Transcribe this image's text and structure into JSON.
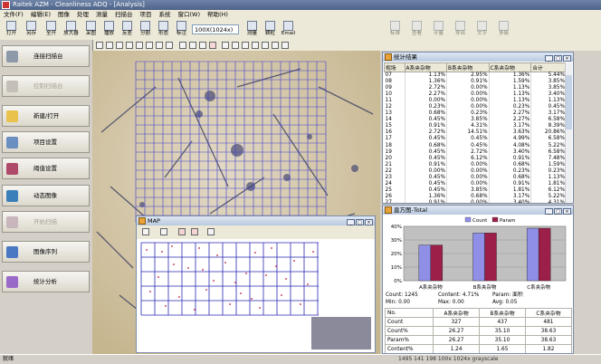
{
  "app": {
    "title": "Raitek AZM - Cleanliness ADQ - [Analysis]"
  },
  "menu": [
    "文件(F)",
    "编辑(E)",
    "图像",
    "处理",
    "测量",
    "扫描台",
    "项目",
    "系统",
    "窗口(W)",
    "帮助(H)"
  ],
  "toolbar": {
    "buttons": [
      "打开",
      "另存",
      "全开",
      "放大器",
      "采图",
      "播放",
      "反差",
      "分割",
      "形态",
      "标注"
    ],
    "zoom_value": "100X(1024x)",
    "extra_buttons": [
      "测量",
      "颗粒",
      "Email"
    ],
    "right_buttons": [
      "标准",
      "查看",
      "计量",
      "导出",
      "文字",
      "多级"
    ]
  },
  "sidebar": {
    "items": [
      {
        "label": "连接扫描台",
        "enabled": true
      },
      {
        "label": "控制扫描台",
        "enabled": false
      },
      {
        "label": "新建/打开",
        "enabled": true
      },
      {
        "label": "项目设置",
        "enabled": true
      },
      {
        "label": "阈值设置",
        "enabled": true
      },
      {
        "label": "动态图像",
        "enabled": true
      },
      {
        "label": "开始扫描",
        "enabled": false
      },
      {
        "label": "图像序列",
        "enabled": true
      },
      {
        "label": "统计分析",
        "enabled": true
      }
    ]
  },
  "map_window": {
    "title": "MAP"
  },
  "stats_window": {
    "title": "统计结果",
    "columns": [
      "视场",
      "A系夹杂物",
      "B系夹杂物",
      "C系夹杂物",
      "合计"
    ],
    "rows": [
      [
        "07",
        "1.13%",
        "2.95%",
        "1.36%",
        "5.44%"
      ],
      [
        "08",
        "1.36%",
        "0.91%",
        "1.59%",
        "3.85%"
      ],
      [
        "09",
        "2.72%",
        "0.00%",
        "1.13%",
        "3.85%"
      ],
      [
        "10",
        "2.27%",
        "0.00%",
        "1.13%",
        "3.40%"
      ],
      [
        "11",
        "0.00%",
        "0.00%",
        "1.13%",
        "1.13%"
      ],
      [
        "12",
        "0.23%",
        "0.00%",
        "0.23%",
        "0.45%"
      ],
      [
        "13",
        "0.68%",
        "0.23%",
        "2.27%",
        "3.17%"
      ],
      [
        "14",
        "0.45%",
        "3.85%",
        "2.27%",
        "6.58%"
      ],
      [
        "15",
        "0.91%",
        "4.31%",
        "3.17%",
        "8.39%"
      ],
      [
        "16",
        "2.72%",
        "14.51%",
        "3.63%",
        "20.86%"
      ],
      [
        "17",
        "0.45%",
        "0.45%",
        "4.99%",
        "6.58%"
      ],
      [
        "18",
        "0.68%",
        "0.45%",
        "4.08%",
        "5.22%"
      ],
      [
        "19",
        "0.45%",
        "2.72%",
        "3.40%",
        "6.58%"
      ],
      [
        "20",
        "0.45%",
        "6.12%",
        "0.91%",
        "7.48%"
      ],
      [
        "21",
        "0.91%",
        "0.00%",
        "0.68%",
        "1.59%"
      ],
      [
        "22",
        "0.00%",
        "0.00%",
        "0.23%",
        "0.23%"
      ],
      [
        "23",
        "0.45%",
        "0.00%",
        "0.68%",
        "1.13%"
      ],
      [
        "24",
        "0.45%",
        "0.00%",
        "0.91%",
        "1.81%"
      ],
      [
        "25",
        "0.45%",
        "3.85%",
        "1.81%",
        "6.12%"
      ],
      [
        "26",
        "1.36%",
        "0.68%",
        "3.17%",
        "5.22%"
      ],
      [
        "27",
        "0.91%",
        "0.00%",
        "3.40%",
        "4.31%"
      ]
    ]
  },
  "histogram_window": {
    "title": "直方图-Total",
    "summary": [
      "Count: 1245",
      "Content: 4.71%",
      "Param: 面积",
      "Min: 0.00",
      "Max: 0.00",
      "Avg: 0.05"
    ],
    "table": {
      "headers": [
        "No.",
        "A系夹杂物",
        "B系夹杂物",
        "C系夹杂物"
      ],
      "rows": [
        [
          "Count",
          "327",
          "437",
          "481"
        ],
        [
          "Count%",
          "26.27",
          "35.10",
          "38.63"
        ],
        [
          "Param%",
          "26.27",
          "35.10",
          "38.63"
        ],
        [
          "Content%",
          "1.24",
          "1.65",
          "1.82"
        ]
      ]
    }
  },
  "chart_data": {
    "type": "bar",
    "categories": [
      "A系夹杂物",
      "B系夹杂物",
      "C系夹杂物"
    ],
    "series": [
      {
        "name": "Count",
        "color": "#8f8fe8",
        "values": [
          26.27,
          35.1,
          38.63
        ]
      },
      {
        "name": "Param",
        "color": "#9c1f4a",
        "values": [
          26.27,
          35.1,
          38.63
        ]
      }
    ],
    "ylim": [
      0,
      40
    ],
    "yticks": [
      "40%",
      "30%",
      "20%",
      "10%",
      "0%"
    ],
    "legend": "top",
    "grid": true
  },
  "status": {
    "left": "就绪",
    "right": "1495  141 198   100x   1024x  grayscale"
  }
}
